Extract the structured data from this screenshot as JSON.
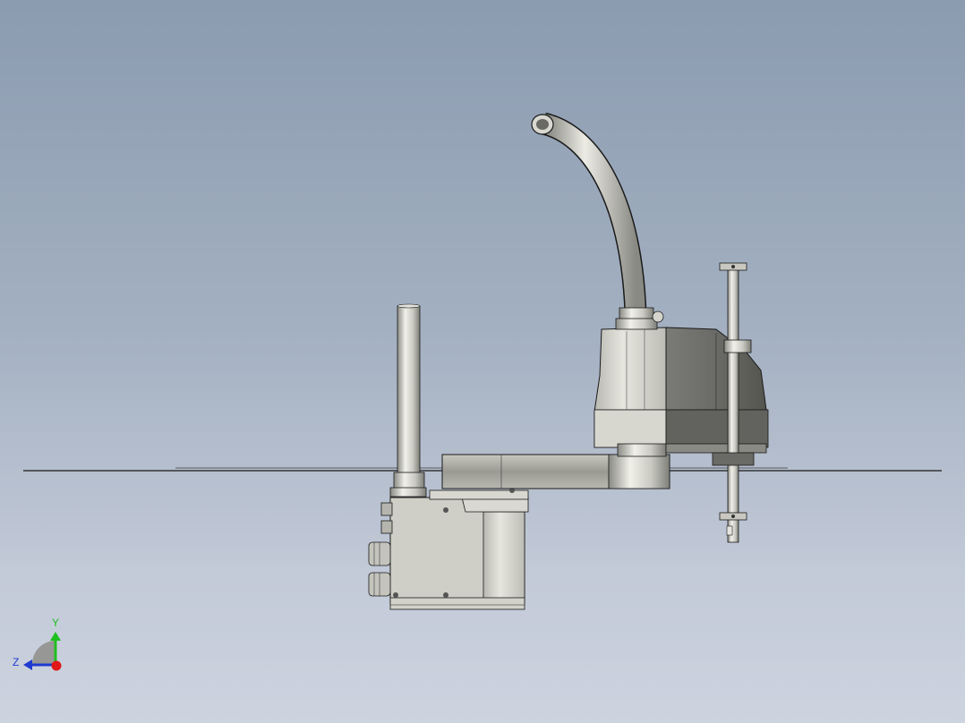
{
  "viewport": {
    "background_top": "#8b9bb0",
    "background_bottom": "#cdd3df"
  },
  "model": {
    "subject": "scara-robot-arm",
    "body_color": "#cfcfc8",
    "shadow_color": "#6e6e6a",
    "outline_color": "#1a1a1a"
  },
  "triad": {
    "y_label": "Y",
    "z_label": "Z",
    "y_color": "#1fbf1f",
    "z_color": "#1f3ad0",
    "x_color": "#e01818"
  }
}
